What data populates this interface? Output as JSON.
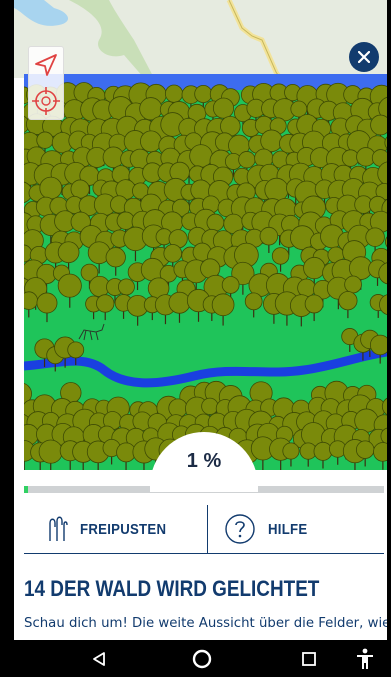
{
  "progress": {
    "percent_label": "1 %",
    "value": 0.01
  },
  "actions": {
    "blow_label": "FREIPUSTEN",
    "help_label": "HILFE"
  },
  "content": {
    "title": "14 DER WALD WIRD GELICHTET",
    "body": "Schau dich um! Die weite Aussicht über die Felder, wie"
  },
  "icons": {
    "close": "close-icon",
    "navigate": "navigate-arrow-icon",
    "locate": "crosshair-icon",
    "blow": "blow-icon",
    "help": "help-circle-icon",
    "back": "back-triangle-icon",
    "home": "home-circle-icon",
    "recents": "recents-square-icon",
    "accessibility": "accessibility-icon"
  },
  "colors": {
    "primary": "#123b6e",
    "progress_fill": "#31d163",
    "progress_track": "#cfd2d4",
    "meadow": "#1fc45a",
    "tree_canopy": "#7a8a0b",
    "river": "#1a3fe0",
    "sky": "#3d6cf0"
  }
}
